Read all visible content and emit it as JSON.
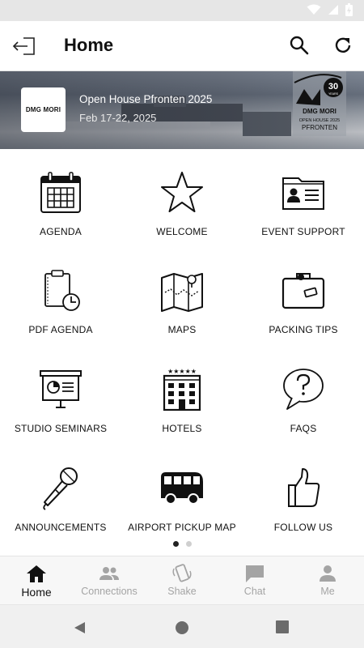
{
  "app_bar": {
    "title": "Home"
  },
  "banner": {
    "logo_text": "DMG MORI",
    "event_title": "Open House Pfronten 2025",
    "event_dates": "Feb 17-22, 2025",
    "badge": {
      "number": "30",
      "years": "YEARS",
      "brand": "DMG MORI",
      "line1": "OPEN HOUSE 2025",
      "line2": "PFRONTEN"
    }
  },
  "tiles": [
    {
      "label": "AGENDA",
      "icon": "calendar-icon"
    },
    {
      "label": "WELCOME",
      "icon": "star-icon"
    },
    {
      "label": "EVENT SUPPORT",
      "icon": "id-card-icon"
    },
    {
      "label": "PDF AGENDA",
      "icon": "clipboard-clock-icon"
    },
    {
      "label": "MAPS",
      "icon": "map-icon"
    },
    {
      "label": "PACKING TIPS",
      "icon": "suitcase-icon"
    },
    {
      "label": "STUDIO SEMINARS",
      "icon": "presentation-icon"
    },
    {
      "label": "HOTELS",
      "icon": "hotel-icon"
    },
    {
      "label": "FAQS",
      "icon": "question-bubble-icon"
    },
    {
      "label": "ANNOUNCEMENTS",
      "icon": "microphone-icon"
    },
    {
      "label": "AIRPORT PICKUP MAP",
      "icon": "bus-icon"
    },
    {
      "label": "FOLLOW US",
      "icon": "thumbs-up-icon"
    }
  ],
  "pager": {
    "pages": 2,
    "current": 1
  },
  "bottom_nav": [
    {
      "label": "Home",
      "icon": "home-icon",
      "active": true
    },
    {
      "label": "Connections",
      "icon": "people-icon",
      "active": false
    },
    {
      "label": "Shake",
      "icon": "shake-phone-icon",
      "active": false
    },
    {
      "label": "Chat",
      "icon": "chat-icon",
      "active": false
    },
    {
      "label": "Me",
      "icon": "person-icon",
      "active": false
    }
  ],
  "colors": {
    "status_bar": "#e6e6e6",
    "active_nav": "#111111",
    "inactive_nav": "#a4a4a4"
  }
}
